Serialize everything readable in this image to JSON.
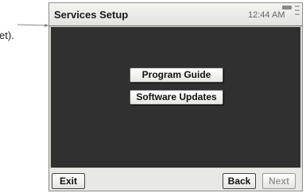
{
  "margin_note": {
    "text": "et)."
  },
  "header": {
    "title": "Services Setup",
    "time": "12:44 AM"
  },
  "menu": {
    "items": [
      {
        "label": "Program Guide"
      },
      {
        "label": "Software Updates"
      }
    ]
  },
  "footer": {
    "exit_label": "Exit",
    "back_label": "Back",
    "next_label": "Next",
    "next_enabled": false
  },
  "colors": {
    "screen_background": "#303030",
    "frame": "#d9d9d4",
    "disabled_text": "#9a9a9a"
  }
}
